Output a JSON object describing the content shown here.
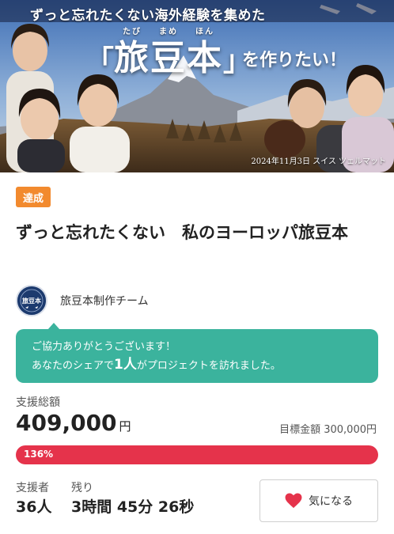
{
  "hero": {
    "headline": "ずっと忘れたくない海外経験を集めた",
    "title_open": "「",
    "title_main": "旅豆本",
    "title_close": "」",
    "ruby": [
      "たび",
      "まめ",
      "ほん"
    ],
    "title_suffix": "を作りたい！",
    "caption": "2024年11月3日 スイス ツェルマット"
  },
  "project": {
    "status_badge": "達成",
    "title": "ずっと忘れたくない　私のヨーロッパ旅豆本",
    "owner_name": "旅豆本制作チーム",
    "avatar_logo_text": "旅豆本"
  },
  "share_message": {
    "line1": "ご協力ありがとうございます！",
    "line2_prefix": "あなたのシェアで",
    "count": "1人",
    "line2_suffix": "がプロジェクトを訪れました。"
  },
  "funding": {
    "total_label": "支援総額",
    "total_amount": "409,000",
    "currency": "円",
    "goal_label": "目標金額",
    "goal_amount": "300,000円",
    "progress_label": "136%",
    "progress_fraction": 1.0
  },
  "stats": {
    "backers_label": "支援者",
    "backers_value": "36人",
    "remaining_label": "残り",
    "remaining_value": "3時間 45分 26秒"
  },
  "actions": {
    "favorite_label": "気になる",
    "favorite_icon": "heart-icon"
  },
  "colors": {
    "badge": "#f28a2e",
    "share_bg": "#3bb39d",
    "progress": "#e5334b",
    "heart": "#e5334b"
  }
}
